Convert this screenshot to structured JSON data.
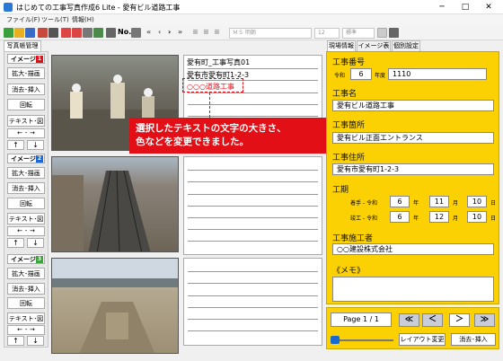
{
  "window": {
    "title": "はじめての工事写真作成6 Lite - 愛有ビル道路工事",
    "minimize": "─",
    "maximize": "□",
    "close": "✕"
  },
  "menu": [
    "ファイル(F)",
    "ツール(T)",
    "情報(H)"
  ],
  "toolbar": {
    "font_name": "ＭＳ 明朝",
    "font_size": "12",
    "style": "標準",
    "no_label": "No."
  },
  "left": {
    "tab": "写真帳管理",
    "images": [
      {
        "label": "イメージ",
        "num": "1",
        "color": "#e30f16"
      },
      {
        "label": "イメージ",
        "num": "2",
        "color": "#1b6ad1"
      },
      {
        "label": "イメージ",
        "num": "3",
        "color": "#3aa53a"
      }
    ],
    "buttons": {
      "zoom": "拡大･描画",
      "delete_insert": "消去･挿入",
      "rotate": "回転",
      "text": "テキスト･図"
    },
    "arrows": {
      "lr": "← ･ →",
      "up": "↑",
      "down": "↓"
    }
  },
  "memo": {
    "line1": "愛有町_工事写真01",
    "line2": "愛有市愛有町1-2-3",
    "line3": "○○○道路工事"
  },
  "callout": {
    "line1": "選択したテキストの文字の大きさ、",
    "line2": "色などを変更できました。"
  },
  "right": {
    "tabs": [
      "現場情報",
      "イメージ表示",
      "個別設定"
    ],
    "koji_bango": "工事番号",
    "era": "令和",
    "year": "6",
    "nendo": "年度",
    "number": "1110",
    "koji_mei": "工事名",
    "koji_mei_val": "愛有ビル道路工事",
    "koji_basho": "工事箇所",
    "koji_basho_val": "愛有ビル正面エントランス",
    "koji_jusho": "工事住所",
    "koji_jusho_val": "愛有市愛有町1-2-3",
    "koki": "工期",
    "start_label": "着手",
    "end_label": "竣工",
    "era2": "- 令和",
    "start": {
      "y": "6",
      "m": "11",
      "d": "10"
    },
    "end": {
      "y": "6",
      "m": "12",
      "d": "10"
    },
    "nen": "年",
    "tsuki": "月",
    "hi": "日",
    "sekosha": "工事施工者",
    "sekosha_val": "○○建設株式会社",
    "memo_label": "《メモ》"
  },
  "nav": {
    "page": "Page 1 / 1",
    "first": "≪",
    "prev": "＜",
    "next": "＞",
    "last": "≫",
    "layout": "レイアウト変更",
    "delete_insert": "消去･挿入"
  }
}
